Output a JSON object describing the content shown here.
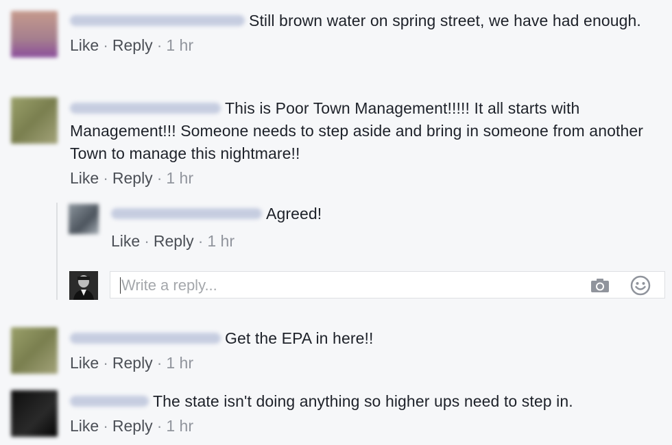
{
  "comments": [
    {
      "text": "Still brown water on spring street, we have had enough.",
      "avatar_color": "#b48a8f",
      "name_color": "#c9cfe0",
      "actions": {
        "like": "Like",
        "reply": "Reply",
        "time": "1 hr"
      }
    },
    {
      "text": "This is Poor Town Management!!!!! It all starts with Management!!! Someone needs to step aside and bring in someone from another Town to manage this nightmare!!",
      "avatar_color": "#8a8f5c",
      "name_color": "#c9cfe0",
      "actions": {
        "like": "Like",
        "reply": "Reply",
        "time": "1 hr"
      }
    },
    {
      "text": "Get the EPA in here!!",
      "avatar_color": "#8a8f5c",
      "name_color": "#c9cfe0",
      "actions": {
        "like": "Like",
        "reply": "Reply",
        "time": "1 hr"
      }
    },
    {
      "text": "The state isn't doing anything so higher ups need to step in.",
      "avatar_color": "#1a1a1a",
      "name_color": "#c9cfe0",
      "actions": {
        "like": "Like",
        "reply": "Reply",
        "time": "1 hr"
      }
    }
  ],
  "reply": {
    "text": "Agreed!",
    "avatar_color": "#5d6670",
    "name_color": "#c9cfe0",
    "actions": {
      "like": "Like",
      "reply": "Reply",
      "time": "1 hr"
    }
  },
  "composer": {
    "placeholder": "Write a reply...",
    "camera_icon": "camera-icon",
    "emoji_icon": "emoji-icon"
  },
  "separator": "·"
}
